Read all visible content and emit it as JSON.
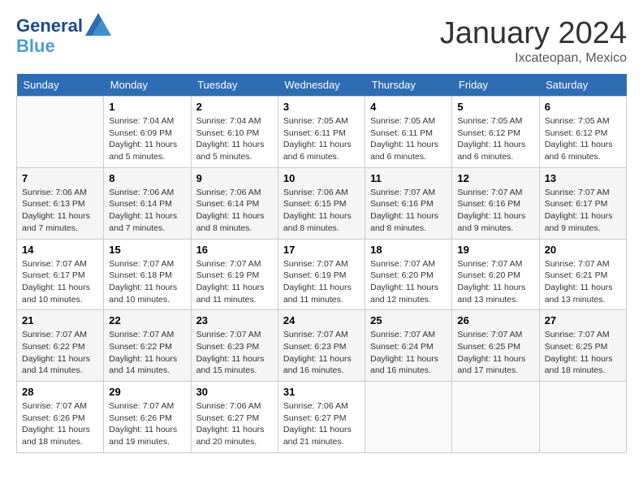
{
  "header": {
    "logo_line1": "General",
    "logo_line2": "Blue",
    "month_title": "January 2024",
    "location": "Ixcateopan, Mexico"
  },
  "days_of_week": [
    "Sunday",
    "Monday",
    "Tuesday",
    "Wednesday",
    "Thursday",
    "Friday",
    "Saturday"
  ],
  "weeks": [
    [
      {
        "num": "",
        "sunrise": "",
        "sunset": "",
        "daylight": ""
      },
      {
        "num": "1",
        "sunrise": "Sunrise: 7:04 AM",
        "sunset": "Sunset: 6:09 PM",
        "daylight": "Daylight: 11 hours and 5 minutes."
      },
      {
        "num": "2",
        "sunrise": "Sunrise: 7:04 AM",
        "sunset": "Sunset: 6:10 PM",
        "daylight": "Daylight: 11 hours and 5 minutes."
      },
      {
        "num": "3",
        "sunrise": "Sunrise: 7:05 AM",
        "sunset": "Sunset: 6:11 PM",
        "daylight": "Daylight: 11 hours and 6 minutes."
      },
      {
        "num": "4",
        "sunrise": "Sunrise: 7:05 AM",
        "sunset": "Sunset: 6:11 PM",
        "daylight": "Daylight: 11 hours and 6 minutes."
      },
      {
        "num": "5",
        "sunrise": "Sunrise: 7:05 AM",
        "sunset": "Sunset: 6:12 PM",
        "daylight": "Daylight: 11 hours and 6 minutes."
      },
      {
        "num": "6",
        "sunrise": "Sunrise: 7:05 AM",
        "sunset": "Sunset: 6:12 PM",
        "daylight": "Daylight: 11 hours and 6 minutes."
      }
    ],
    [
      {
        "num": "7",
        "sunrise": "Sunrise: 7:06 AM",
        "sunset": "Sunset: 6:13 PM",
        "daylight": "Daylight: 11 hours and 7 minutes."
      },
      {
        "num": "8",
        "sunrise": "Sunrise: 7:06 AM",
        "sunset": "Sunset: 6:14 PM",
        "daylight": "Daylight: 11 hours and 7 minutes."
      },
      {
        "num": "9",
        "sunrise": "Sunrise: 7:06 AM",
        "sunset": "Sunset: 6:14 PM",
        "daylight": "Daylight: 11 hours and 8 minutes."
      },
      {
        "num": "10",
        "sunrise": "Sunrise: 7:06 AM",
        "sunset": "Sunset: 6:15 PM",
        "daylight": "Daylight: 11 hours and 8 minutes."
      },
      {
        "num": "11",
        "sunrise": "Sunrise: 7:07 AM",
        "sunset": "Sunset: 6:16 PM",
        "daylight": "Daylight: 11 hours and 8 minutes."
      },
      {
        "num": "12",
        "sunrise": "Sunrise: 7:07 AM",
        "sunset": "Sunset: 6:16 PM",
        "daylight": "Daylight: 11 hours and 9 minutes."
      },
      {
        "num": "13",
        "sunrise": "Sunrise: 7:07 AM",
        "sunset": "Sunset: 6:17 PM",
        "daylight": "Daylight: 11 hours and 9 minutes."
      }
    ],
    [
      {
        "num": "14",
        "sunrise": "Sunrise: 7:07 AM",
        "sunset": "Sunset: 6:17 PM",
        "daylight": "Daylight: 11 hours and 10 minutes."
      },
      {
        "num": "15",
        "sunrise": "Sunrise: 7:07 AM",
        "sunset": "Sunset: 6:18 PM",
        "daylight": "Daylight: 11 hours and 10 minutes."
      },
      {
        "num": "16",
        "sunrise": "Sunrise: 7:07 AM",
        "sunset": "Sunset: 6:19 PM",
        "daylight": "Daylight: 11 hours and 11 minutes."
      },
      {
        "num": "17",
        "sunrise": "Sunrise: 7:07 AM",
        "sunset": "Sunset: 6:19 PM",
        "daylight": "Daylight: 11 hours and 11 minutes."
      },
      {
        "num": "18",
        "sunrise": "Sunrise: 7:07 AM",
        "sunset": "Sunset: 6:20 PM",
        "daylight": "Daylight: 11 hours and 12 minutes."
      },
      {
        "num": "19",
        "sunrise": "Sunrise: 7:07 AM",
        "sunset": "Sunset: 6:20 PM",
        "daylight": "Daylight: 11 hours and 13 minutes."
      },
      {
        "num": "20",
        "sunrise": "Sunrise: 7:07 AM",
        "sunset": "Sunset: 6:21 PM",
        "daylight": "Daylight: 11 hours and 13 minutes."
      }
    ],
    [
      {
        "num": "21",
        "sunrise": "Sunrise: 7:07 AM",
        "sunset": "Sunset: 6:22 PM",
        "daylight": "Daylight: 11 hours and 14 minutes."
      },
      {
        "num": "22",
        "sunrise": "Sunrise: 7:07 AM",
        "sunset": "Sunset: 6:22 PM",
        "daylight": "Daylight: 11 hours and 14 minutes."
      },
      {
        "num": "23",
        "sunrise": "Sunrise: 7:07 AM",
        "sunset": "Sunset: 6:23 PM",
        "daylight": "Daylight: 11 hours and 15 minutes."
      },
      {
        "num": "24",
        "sunrise": "Sunrise: 7:07 AM",
        "sunset": "Sunset: 6:23 PM",
        "daylight": "Daylight: 11 hours and 16 minutes."
      },
      {
        "num": "25",
        "sunrise": "Sunrise: 7:07 AM",
        "sunset": "Sunset: 6:24 PM",
        "daylight": "Daylight: 11 hours and 16 minutes."
      },
      {
        "num": "26",
        "sunrise": "Sunrise: 7:07 AM",
        "sunset": "Sunset: 6:25 PM",
        "daylight": "Daylight: 11 hours and 17 minutes."
      },
      {
        "num": "27",
        "sunrise": "Sunrise: 7:07 AM",
        "sunset": "Sunset: 6:25 PM",
        "daylight": "Daylight: 11 hours and 18 minutes."
      }
    ],
    [
      {
        "num": "28",
        "sunrise": "Sunrise: 7:07 AM",
        "sunset": "Sunset: 6:26 PM",
        "daylight": "Daylight: 11 hours and 18 minutes."
      },
      {
        "num": "29",
        "sunrise": "Sunrise: 7:07 AM",
        "sunset": "Sunset: 6:26 PM",
        "daylight": "Daylight: 11 hours and 19 minutes."
      },
      {
        "num": "30",
        "sunrise": "Sunrise: 7:06 AM",
        "sunset": "Sunset: 6:27 PM",
        "daylight": "Daylight: 11 hours and 20 minutes."
      },
      {
        "num": "31",
        "sunrise": "Sunrise: 7:06 AM",
        "sunset": "Sunset: 6:27 PM",
        "daylight": "Daylight: 11 hours and 21 minutes."
      },
      {
        "num": "",
        "sunrise": "",
        "sunset": "",
        "daylight": ""
      },
      {
        "num": "",
        "sunrise": "",
        "sunset": "",
        "daylight": ""
      },
      {
        "num": "",
        "sunrise": "",
        "sunset": "",
        "daylight": ""
      }
    ]
  ]
}
